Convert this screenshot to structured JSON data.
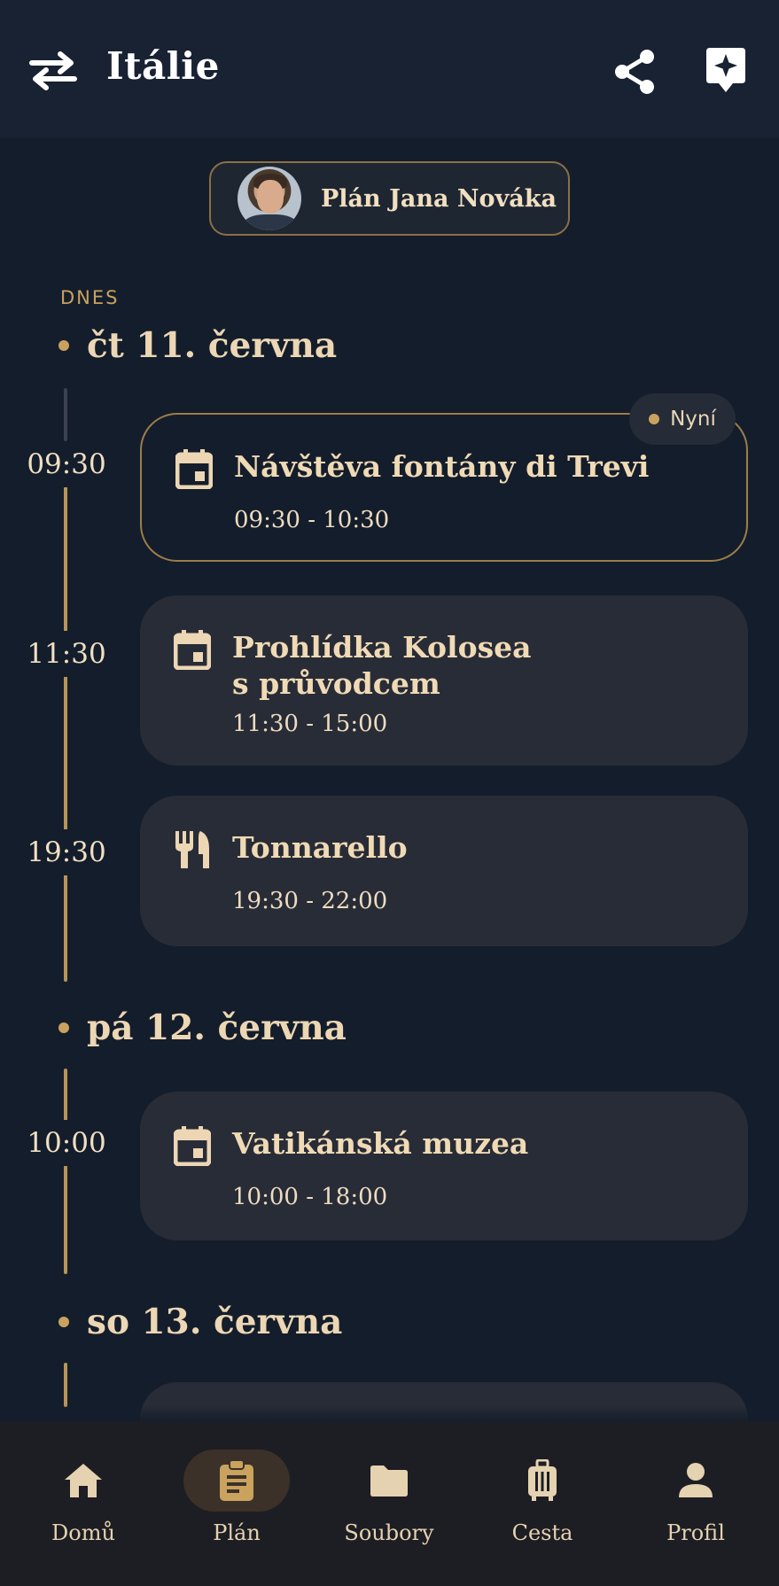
{
  "header": {
    "title": "Itálie"
  },
  "owner": {
    "name": "Plán Jana Nováka"
  },
  "today_label": "DNES",
  "now_badge": "Nyní",
  "days": [
    {
      "label": "čt 11. června",
      "events": [
        {
          "start": "09:30",
          "title": "Návštěva fontány di Trevi",
          "range": "09:30 - 10:30",
          "icon": "calendar-icon",
          "current": true
        },
        {
          "start": "11:30",
          "title": "Prohlídka Kolosea s průvodcem",
          "title_line1": "Prohlídka Kolosea",
          "title_line2": "s průvodcem",
          "range": "11:30 - 15:00",
          "icon": "calendar-icon"
        },
        {
          "start": "19:30",
          "title": "Tonnarello",
          "range": "19:30 - 22:00",
          "icon": "restaurant-icon"
        }
      ]
    },
    {
      "label": "pá 12. června",
      "events": [
        {
          "start": "10:00",
          "title": "Vatikánská muzea",
          "range": "10:00 - 18:00",
          "icon": "calendar-icon"
        }
      ]
    },
    {
      "label": "so 13. června",
      "events": []
    }
  ],
  "nav": [
    {
      "label": "Domů",
      "icon": "home-icon"
    },
    {
      "label": "Plán",
      "icon": "clipboard-icon",
      "active": true
    },
    {
      "label": "Soubory",
      "icon": "folder-icon"
    },
    {
      "label": "Cesta",
      "icon": "luggage-icon"
    },
    {
      "label": "Profil",
      "icon": "person-icon"
    }
  ],
  "colors": {
    "background": "#141d2b",
    "header": "#192233",
    "card": "#282c37",
    "accent": "#c9a25e",
    "text": "#ecd6b4"
  }
}
